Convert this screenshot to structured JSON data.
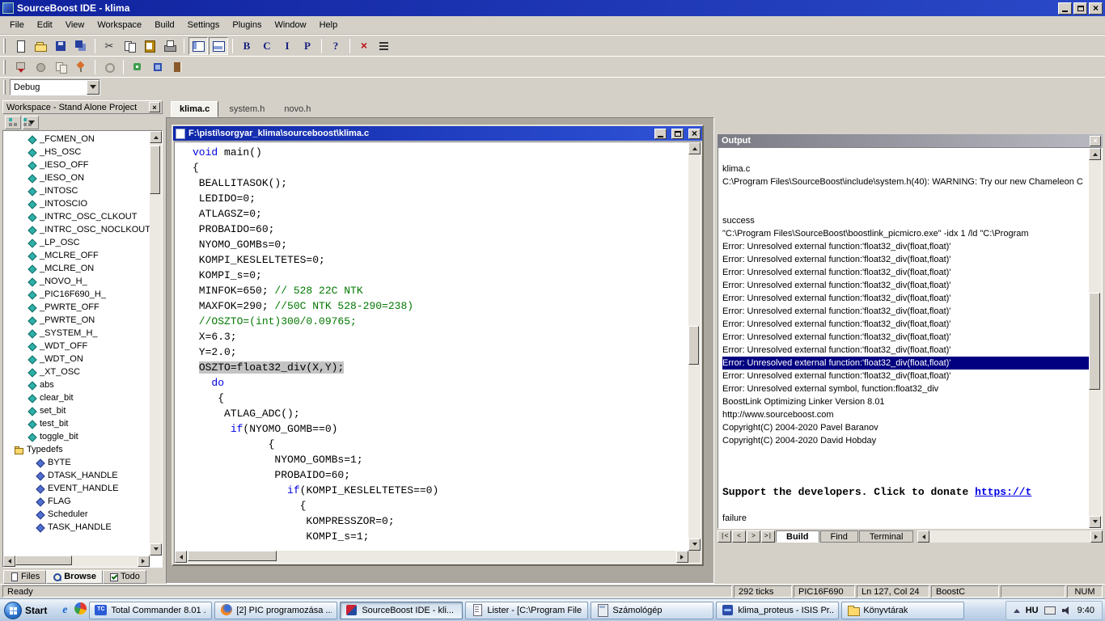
{
  "window": {
    "title": "SourceBoost IDE - klima"
  },
  "menu": {
    "items": [
      "File",
      "Edit",
      "View",
      "Workspace",
      "Build",
      "Settings",
      "Plugins",
      "Window",
      "Help"
    ]
  },
  "toolbar_main": {
    "buttons": [
      {
        "name": "new-file-button",
        "icon": "page"
      },
      {
        "name": "open-file-button",
        "icon": "folderopen"
      },
      {
        "name": "save-button",
        "icon": "floppy"
      },
      {
        "name": "save-all-button",
        "icon": "floppystack"
      },
      {
        "sep": true
      },
      {
        "name": "cut-button",
        "icon": "scissors"
      },
      {
        "name": "copy-button",
        "icon": "copy"
      },
      {
        "name": "paste-button",
        "icon": "clipboard"
      },
      {
        "name": "print-button",
        "icon": "printer"
      },
      {
        "sep": true
      },
      {
        "name": "toggle-workspace-pane-button",
        "icon": "paneleft",
        "pressed": true
      },
      {
        "name": "toggle-output-pane-button",
        "icon": "panebottom",
        "pressed": true
      },
      {
        "sep": true
      },
      {
        "name": "tool-b-button",
        "icon": "letter",
        "char": "B"
      },
      {
        "name": "tool-c-button",
        "icon": "letter",
        "char": "C"
      },
      {
        "name": "tool-i-button",
        "icon": "letter",
        "char": "I"
      },
      {
        "name": "tool-p-button",
        "icon": "letter",
        "char": "P"
      },
      {
        "sep": true
      },
      {
        "name": "help-button",
        "icon": "letter",
        "char": "?"
      },
      {
        "sep": true
      },
      {
        "name": "stop-build-button",
        "icon": "redx",
        "char": "×"
      },
      {
        "name": "output-list-button",
        "icon": "list"
      }
    ]
  },
  "toolbar_secondary": {
    "buttons": [
      {
        "name": "tool2-export-button",
        "icon": "m1"
      },
      {
        "name": "tool2-blob-button",
        "icon": "m2"
      },
      {
        "name": "tool2-pages-button",
        "icon": "m3"
      },
      {
        "name": "tool2-pin-button",
        "icon": "m4"
      },
      {
        "sep": true
      },
      {
        "name": "tool2-ring-button",
        "icon": "m5"
      },
      {
        "sep": true
      },
      {
        "name": "tool2-plugin-button",
        "icon": "m6"
      },
      {
        "name": "tool2-chip-button",
        "icon": "m7"
      },
      {
        "name": "tool2-notes-button",
        "icon": "m8"
      }
    ]
  },
  "build_config": {
    "value": "Debug"
  },
  "workspace": {
    "title": "Workspace - Stand Alone Project",
    "members": [
      "_FCMEN_ON",
      "_HS_OSC",
      "_IESO_OFF",
      "_IESO_ON",
      "_INTOSC",
      "_INTOSCIO",
      "_INTRC_OSC_CLKOUT",
      "_INTRC_OSC_NOCLKOUT",
      "_LP_OSC",
      "_MCLRE_OFF",
      "_MCLRE_ON",
      "_NOVO_H_",
      "_PIC16F690_H_",
      "_PWRTE_OFF",
      "_PWRTE_ON",
      "_SYSTEM_H_",
      "_WDT_OFF",
      "_WDT_ON",
      "_XT_OSC",
      "abs",
      "clear_bit",
      "set_bit",
      "test_bit",
      "toggle_bit"
    ],
    "typedefs_label": "Typedefs",
    "typedefs": [
      "BYTE",
      "DTASK_HANDLE",
      "EVENT_HANDLE",
      "FLAG",
      "Scheduler",
      "TASK_HANDLE"
    ],
    "tabs": [
      {
        "label": "Files"
      },
      {
        "label": "Browse",
        "active": true
      },
      {
        "label": "Todo"
      }
    ]
  },
  "editor": {
    "doc_tabs": [
      {
        "label": "klima.c",
        "active": true
      },
      {
        "label": "system.h"
      },
      {
        "label": "novo.h"
      }
    ],
    "child_title": "F:\\pisti\\sorgyar_klima\\sourceboost\\klima.c",
    "code": [
      {
        "s": [
          [
            "k",
            "void"
          ],
          [
            "p",
            " main()"
          ]
        ]
      },
      {
        "s": [
          [
            "p",
            "{"
          ]
        ]
      },
      {
        "s": [
          [
            "p",
            " BEALLITASOK();"
          ]
        ]
      },
      {
        "s": [
          [
            "p",
            " LEDIDO=0;"
          ]
        ]
      },
      {
        "s": [
          [
            "p",
            " ATLAGSZ=0;"
          ]
        ]
      },
      {
        "s": [
          [
            "p",
            " PROBAIDO=60;"
          ]
        ]
      },
      {
        "s": [
          [
            "p",
            " NYOMO_GOMBs=0;"
          ]
        ]
      },
      {
        "s": [
          [
            "p",
            " KOMPI_KESLELTETES=0;"
          ]
        ]
      },
      {
        "s": [
          [
            "p",
            " KOMPI_s=0;"
          ]
        ]
      },
      {
        "s": [
          [
            "p",
            " MINFOK=650; "
          ],
          [
            "c",
            "// 528 22C NTK"
          ]
        ]
      },
      {
        "s": [
          [
            "p",
            " MAXFOK=290; "
          ],
          [
            "c",
            "//50C NTK 528-290=238)"
          ]
        ]
      },
      {
        "s": [
          [
            "c",
            " //OSZTO=(int)300/0.09765;"
          ]
        ]
      },
      {
        "s": [
          [
            "p",
            " X=6.3;"
          ]
        ]
      },
      {
        "s": [
          [
            "p",
            " Y=2.0;"
          ]
        ]
      },
      {
        "s": [
          [
            "p",
            " "
          ],
          [
            "h",
            "OSZTO=float32_div(X,Y);"
          ]
        ]
      },
      {
        "s": [
          [
            "p",
            "   "
          ],
          [
            "k",
            "do"
          ]
        ]
      },
      {
        "s": [
          [
            "p",
            "    {"
          ]
        ]
      },
      {
        "s": [
          [
            "p",
            "     ATLAG_ADC();"
          ]
        ]
      },
      {
        "s": [
          [
            "p",
            "      "
          ],
          [
            "k",
            "if"
          ],
          [
            "p",
            "(NYOMO_GOMB==0)"
          ]
        ]
      },
      {
        "s": [
          [
            "p",
            "            {"
          ]
        ]
      },
      {
        "s": [
          [
            "p",
            "             NYOMO_GOMBs=1;"
          ]
        ]
      },
      {
        "s": [
          [
            "p",
            "             PROBAIDO=60;"
          ]
        ]
      },
      {
        "s": [
          [
            "p",
            "               "
          ],
          [
            "k",
            "if"
          ],
          [
            "p",
            "(KOMPI_KESLELTETES==0)"
          ]
        ]
      },
      {
        "s": [
          [
            "p",
            "                 {"
          ]
        ]
      },
      {
        "s": [
          [
            "p",
            "                  KOMPRESSZOR=0;"
          ]
        ]
      },
      {
        "s": [
          [
            "p",
            "                  KOMPI_s=1;"
          ]
        ]
      }
    ]
  },
  "output": {
    "title": "Output",
    "nav": [
      "|<",
      "<",
      ">",
      ">|"
    ],
    "lines": [
      {
        "t": ""
      },
      {
        "t": "klima.c"
      },
      {
        "t": "C:\\Program Files\\SourceBoost\\include\\system.h(40): WARNING: Try our new Chameleon C"
      },
      {
        "t": ""
      },
      {
        "t": ""
      },
      {
        "t": "success"
      },
      {
        "t": "\"C:\\Program Files\\SourceBoost\\boostlink_picmicro.exe\"  -idx 1  /ld \"C:\\Program"
      },
      {
        "t": "Error: Unresolved external function:'float32_div(float,float)'"
      },
      {
        "t": "Error: Unresolved external function:'float32_div(float,float)'"
      },
      {
        "t": "Error: Unresolved external function:'float32_div(float,float)'"
      },
      {
        "t": "Error: Unresolved external function:'float32_div(float,float)'"
      },
      {
        "t": "Error: Unresolved external function:'float32_div(float,float)'"
      },
      {
        "t": "Error: Unresolved external function:'float32_div(float,float)'"
      },
      {
        "t": "Error: Unresolved external function:'float32_div(float,float)'"
      },
      {
        "t": "Error: Unresolved external function:'float32_div(float,float)'"
      },
      {
        "t": "Error: Unresolved external function:'float32_div(float,float)'"
      },
      {
        "t": "Error: Unresolved external function:'float32_div(float,float)'",
        "sel": true
      },
      {
        "t": "Error: Unresolved external function:'float32_div(float,float)'"
      },
      {
        "t": "Error: Unresolved external symbol, function:float32_div"
      },
      {
        "t": "BoostLink Optimizing Linker Version 8.01"
      },
      {
        "t": "http://www.sourceboost.com"
      },
      {
        "t": "Copyright(C) 2004-2020 Pavel Baranov"
      },
      {
        "t": "Copyright(C) 2004-2020 David Hobday"
      },
      {
        "t": ""
      },
      {
        "t": ""
      },
      {
        "t": ""
      },
      {
        "kind": "support",
        "pre": "Support the developers. Click to donate ",
        "link": "https://t"
      },
      {
        "t": ""
      },
      {
        "t": "failure"
      }
    ],
    "tabs": [
      {
        "label": "Build",
        "active": true
      },
      {
        "label": "Find"
      },
      {
        "label": "Terminal"
      }
    ]
  },
  "status_bar": {
    "ready": "Ready",
    "ticks": "292 ticks",
    "device": "PIC16F690",
    "position": "Ln 127, Col 24",
    "compiler": "BoostC",
    "num": "NUM"
  },
  "taskbar": {
    "start_label": "Start",
    "quick_launch": [
      {
        "icon": "ie-icon"
      },
      {
        "icon": "browser-ball-icon"
      }
    ],
    "tasks": [
      {
        "label": "Total Commander 8.01 ...",
        "icon": "totalcommander-icon"
      },
      {
        "label": "[2] PIC programozása ...",
        "icon": "firefox-icon"
      },
      {
        "label": "SourceBoost IDE - kli...",
        "icon": "sourceboost-icon",
        "active": true
      },
      {
        "label": "Lister - [C:\\Program File...",
        "icon": "lister-icon"
      },
      {
        "label": "Számológép",
        "icon": "calculator-icon"
      },
      {
        "label": "klima_proteus - ISIS Pr...",
        "icon": "isis-icon"
      },
      {
        "label": "Könyvtárak",
        "icon": "folder-icon"
      }
    ],
    "tray": {
      "lang": "HU",
      "time": "9:40"
    }
  },
  "colors": {
    "accent": "#10229e",
    "selection": "#000080",
    "keyword": "#0000e0",
    "comment": "#007800"
  }
}
